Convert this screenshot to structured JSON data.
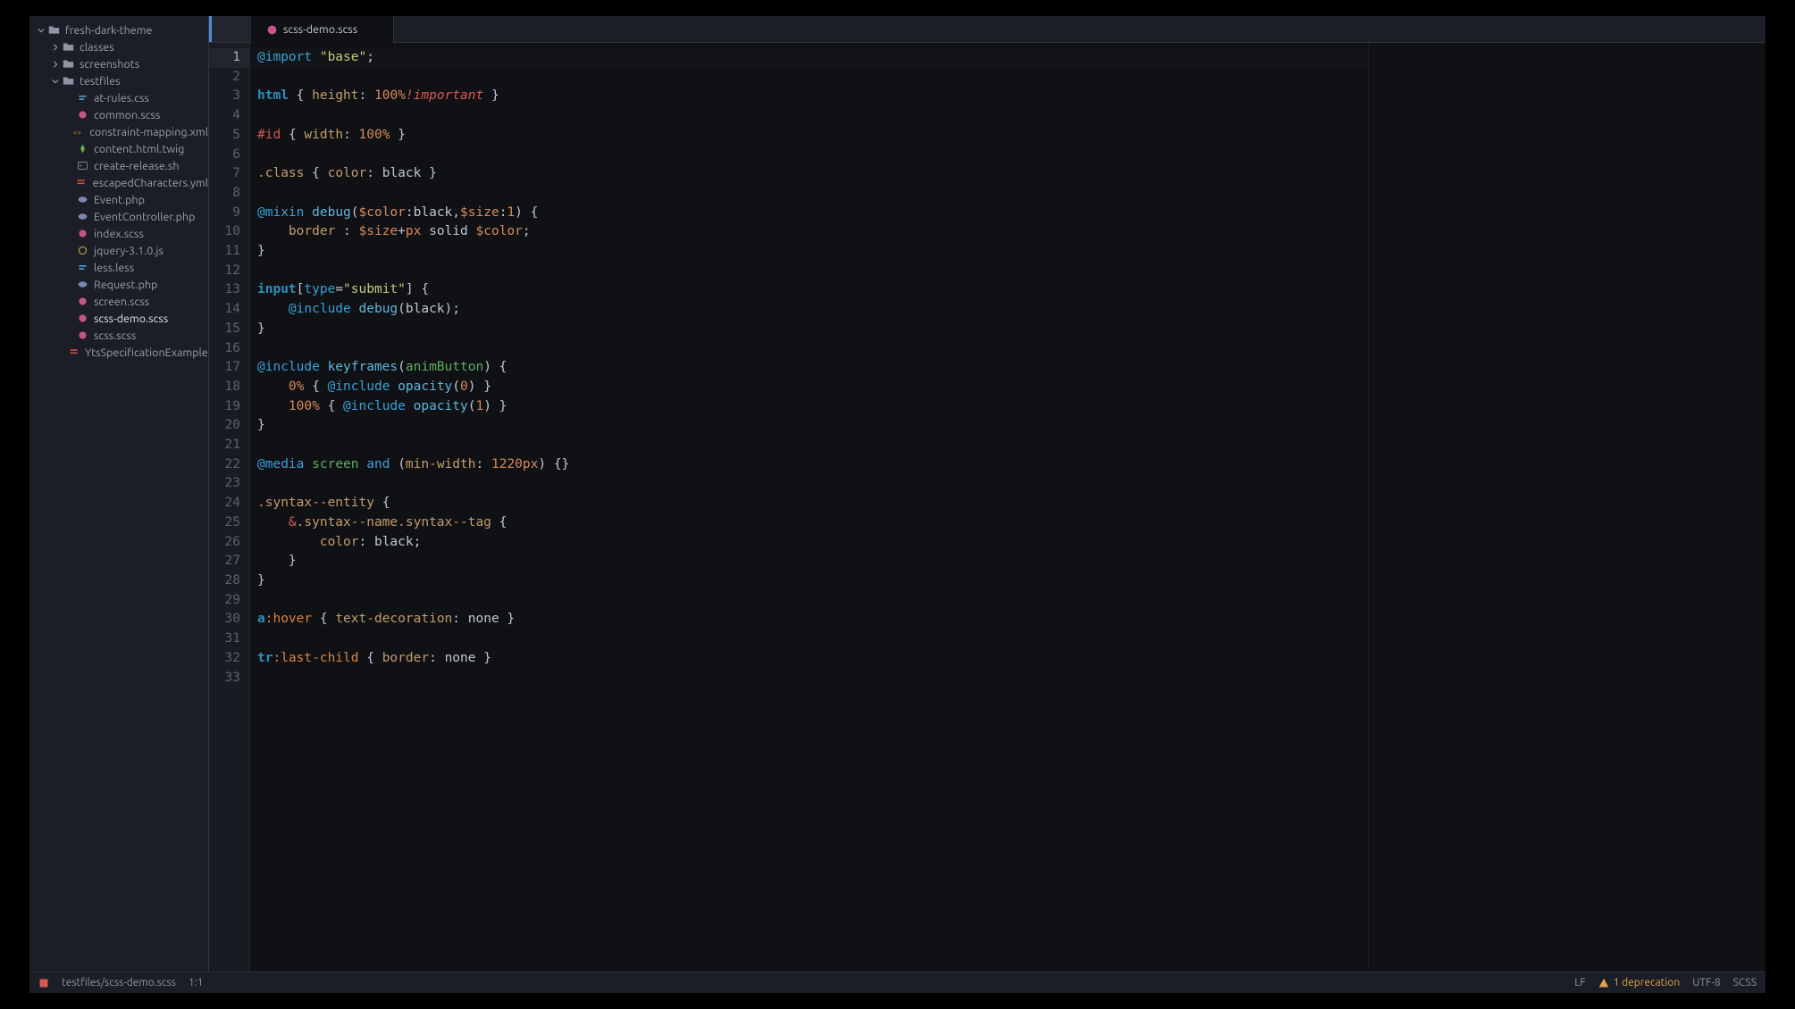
{
  "tree": {
    "root": {
      "name": "fresh-dark-theme"
    },
    "folders": [
      {
        "name": "classes",
        "expanded": false
      },
      {
        "name": "screenshots",
        "expanded": false
      },
      {
        "name": "testfiles",
        "expanded": true
      }
    ],
    "files": [
      {
        "name": "at-rules.css",
        "type": "css"
      },
      {
        "name": "common.scss",
        "type": "scss"
      },
      {
        "name": "constraint-mapping.xml",
        "type": "xml"
      },
      {
        "name": "content.html.twig",
        "type": "twig"
      },
      {
        "name": "create-release.sh",
        "type": "sh"
      },
      {
        "name": "escapedCharacters.yml",
        "type": "yml"
      },
      {
        "name": "Event.php",
        "type": "php"
      },
      {
        "name": "EventController.php",
        "type": "php"
      },
      {
        "name": "index.scss",
        "type": "scss"
      },
      {
        "name": "jquery-3.1.0.js",
        "type": "js"
      },
      {
        "name": "less.less",
        "type": "less"
      },
      {
        "name": "Request.php",
        "type": "php"
      },
      {
        "name": "screen.scss",
        "type": "scss"
      },
      {
        "name": "scss-demo.scss",
        "type": "scss",
        "active": true
      },
      {
        "name": "scss.scss",
        "type": "scss"
      },
      {
        "name": "YtsSpecificationExamples.yml",
        "type": "yml"
      }
    ]
  },
  "tab": {
    "filename": "scss-demo.scss"
  },
  "editor": {
    "line_count": 33,
    "current_line": 1
  },
  "code": {
    "l1": {
      "atrule": "@import",
      "str": "\"base\"",
      "semi": ";"
    },
    "l3": {
      "sel": "html",
      "prop": "height",
      "num": "100",
      "unit": "%",
      "important": "!important"
    },
    "l5": {
      "sel": "#id",
      "prop": "width",
      "num": "100",
      "unit": "%"
    },
    "l7": {
      "sel": ".class",
      "prop": "color",
      "val": "black"
    },
    "l9": {
      "atrule": "@mixin",
      "name": "debug",
      "var1": "$color",
      "def1": "black",
      "var2": "$size",
      "def2": "1"
    },
    "l10": {
      "prop": "border",
      "var": "$size",
      "op": "+",
      "unit": "px",
      "val1": "solid",
      "var2": "$color"
    },
    "l13": {
      "sel": "input",
      "attr": "type",
      "attrval": "\"submit\""
    },
    "l14": {
      "atrule": "@include",
      "name": "debug",
      "arg": "black"
    },
    "l17": {
      "atrule": "@include",
      "name": "keyframes",
      "arg": "animButton"
    },
    "l18": {
      "pct": "0%",
      "atrule": "@include",
      "name": "opacity",
      "arg": "0"
    },
    "l19": {
      "pct": "100%",
      "atrule": "@include",
      "name": "opacity",
      "arg": "1"
    },
    "l22": {
      "atrule": "@media",
      "screen": "screen",
      "and": "and",
      "feat": "min-width",
      "num": "1220",
      "unit": "px"
    },
    "l24": {
      "sel": ".syntax--entity"
    },
    "l25": {
      "amp": "&",
      "sel1": ".syntax--name",
      "sel2": ".syntax--tag"
    },
    "l26": {
      "prop": "color",
      "val": "black"
    },
    "l30": {
      "sel": "a",
      "pseudo": ":hover",
      "prop": "text-decoration",
      "val": "none"
    },
    "l32": {
      "sel": "tr",
      "pseudo": ":last-child",
      "prop": "border",
      "val": "none"
    }
  },
  "statusbar": {
    "path": "testfiles/scss-demo.scss",
    "cursor": "1:1",
    "eol": "LF",
    "deprecation": "1 deprecation",
    "encoding": "UTF-8",
    "language": "SCSS"
  }
}
